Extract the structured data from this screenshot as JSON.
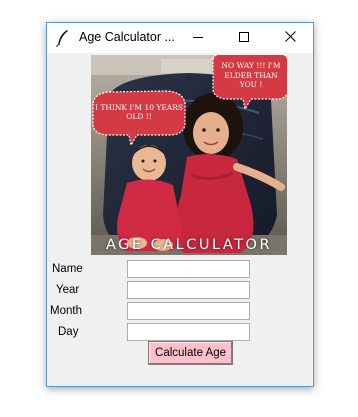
{
  "window": {
    "title": "Age Calculator ..."
  },
  "image": {
    "caption": "AGE CALCULATOR",
    "bubble_left": "I THINK I'M 10 YEARS OLD !!",
    "bubble_right_line1": "NO WAY !!! I'M",
    "bubble_right_line2": "ELDER THAN YOU !"
  },
  "form": {
    "name_label": "Name",
    "year_label": "Year",
    "month_label": "Month",
    "day_label": "Day",
    "name_value": "",
    "year_value": "",
    "month_value": "",
    "day_value": ""
  },
  "button": {
    "label": "Calculate Age",
    "color": "#ffc0cb"
  },
  "icons": [
    "feather-icon",
    "minimize-icon",
    "maximize-icon",
    "close-icon"
  ]
}
